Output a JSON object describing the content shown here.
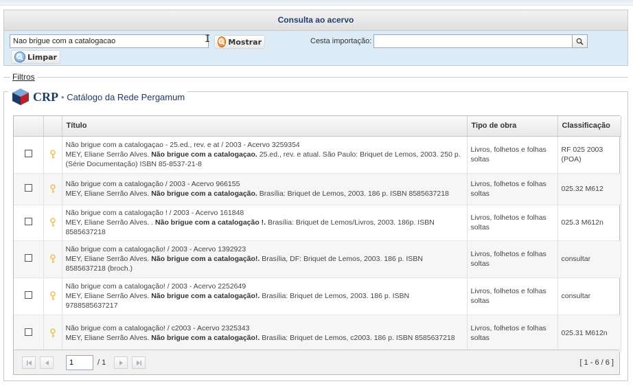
{
  "header": {
    "title": "Consulta ao acervo"
  },
  "search": {
    "query": "Nao brigue com a catalogacao",
    "show_label": "Mostrar",
    "clear_label": "Limpar",
    "cesta_label": "Cesta importação:",
    "cesta_value": ""
  },
  "filters": {
    "label": "Filtros"
  },
  "catalog": {
    "logo_text": "CRP",
    "bullet": "•",
    "name": "Catálogo da Rede Pergamum"
  },
  "table": {
    "headers": [
      "",
      "",
      "Título",
      "Tipo de obra",
      "Classificação"
    ],
    "rows": [
      {
        "title": "Não brigue com a catalogaçao - 25.ed., rev. e at / 2003 - Acervo 3259354",
        "author": "MEY, Eliane Serrão Alves.",
        "bold": "Não brigue com a catalogaçao.",
        "rest": "25.ed., rev. e atual. São Paulo: Briquet de Lemos, 2003. 250 p. (Série Documentação) ISBN 85-8537-21-8",
        "type": "Livros, folhetos e folhas soltas",
        "class": "RF 025 2003 (POA)"
      },
      {
        "title": "Não brigue com a catalogação / 2003 - Acervo 966155",
        "author": "MEY, Eliane Serrão Alves.",
        "bold": "Não brigue com a catalogação.",
        "rest": "Brasília: Briquet de Lemos, 2003. 186 p. ISBN 8585637218",
        "type": "Livros, folhetos e folhas soltas",
        "class": "025.32 M612"
      },
      {
        "title": "Não brigue com a catalogação ! / 2003 - Acervo 161848",
        "author": "MEY, Eliane Serrão Alves. .",
        "bold": "Não brigue com a catalogação !.",
        "rest": "Brasília: Briquet de Lemos/Livros, 2003. 186p. ISBN 8585637218",
        "type": "Livros, folhetos e folhas soltas",
        "class": "025.3 M612n"
      },
      {
        "title": "Não brigue com a catalogação! / 2003 - Acervo 1392923",
        "author": "MEY, Eliane Serrão Alves.",
        "bold": "Não brigue com a catalogação!.",
        "rest": "Brasília, DF: Briquet de Lemos, 2003. 186 p. ISBN 8585637218 (broch.)",
        "type": "Livros, folhetos e folhas soltas",
        "class": "consultar"
      },
      {
        "title": "Não brigue com a catalogação! / 2003 - Acervo 2252649",
        "author": "MEY, Eliane Serrão Alves.",
        "bold": "Não brigue com a catalogação!.",
        "rest": "Brasília: Briquet de Lemos, 2003. 186 p. ISBN 9788585637217",
        "type": "Livros, folhetos e folhas soltas",
        "class": "consultar"
      },
      {
        "title": "Não brigue com a catalogação! / c2003 - Acervo 2325343",
        "author": "MEY, Eliane Serrão Alves.",
        "bold": "Não brigue com a catalogação!.",
        "rest": "Brasília: Briquet de Lemos, c2003. 186 p. ISBN 8585637218",
        "type": "Livros, folhetos e folhas soltas",
        "class": "025.31 M612n"
      }
    ]
  },
  "pager": {
    "page": "1",
    "total": "/ 1",
    "range": "[ 1 - 6 / 6 ]"
  },
  "icons": {
    "show": "magnifier-orange-icon",
    "clear": "magnifier-blue-icon",
    "cesta_search": "magnifier-icon",
    "row": "key-icon",
    "first": "first-page-icon",
    "prev": "prev-page-icon",
    "next": "next-page-icon",
    "last": "last-page-icon"
  },
  "colors": {
    "panel": "#dcebf6",
    "brand": "#1d3a66",
    "key": "#f0c060"
  }
}
